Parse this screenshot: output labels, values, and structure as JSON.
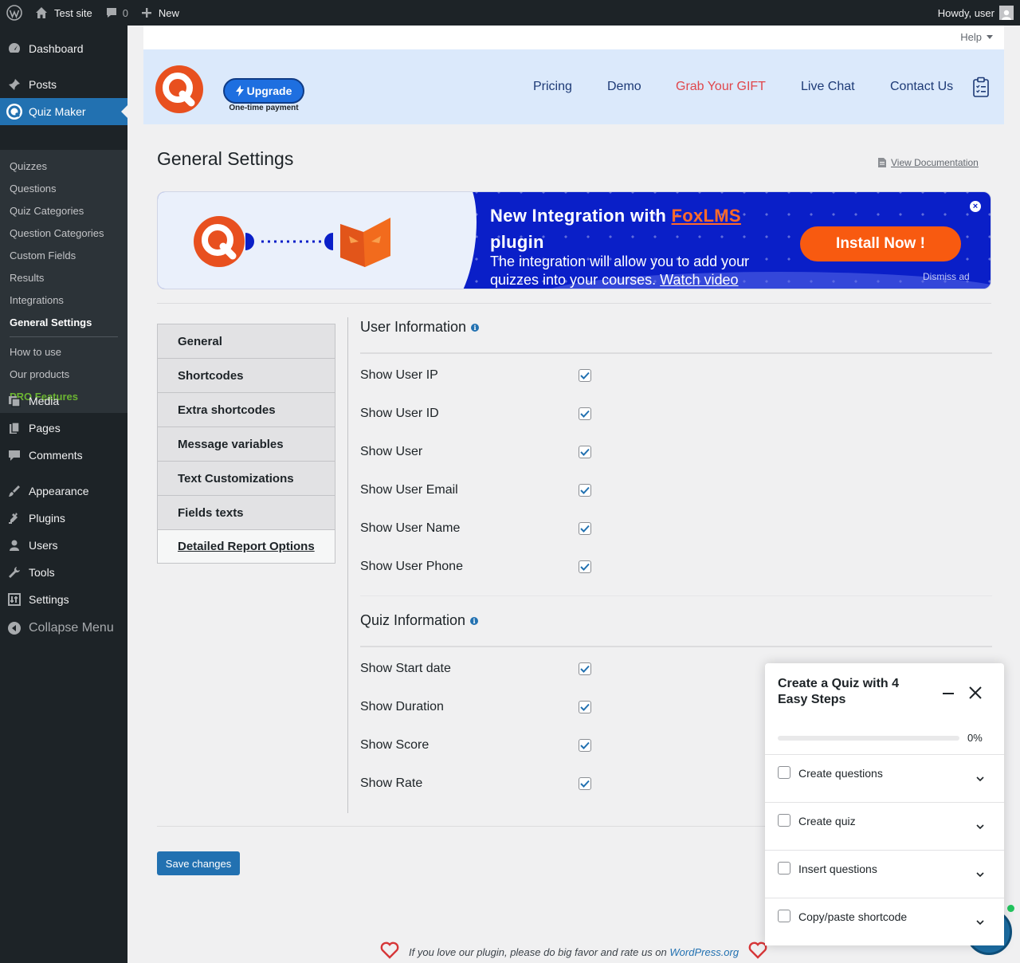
{
  "admin_bar": {
    "site_name": "Test site",
    "comments_count": "0",
    "new_label": "New",
    "greeting": "Howdy, user"
  },
  "sidebar": {
    "dashboard": "Dashboard",
    "posts": "Posts",
    "quiz_maker": "Quiz Maker",
    "submenu": [
      "Quizzes",
      "Questions",
      "Quiz Categories",
      "Question Categories",
      "Custom Fields",
      "Results",
      "Integrations",
      "General Settings"
    ],
    "submenu_extra": [
      "How to use",
      "Our products"
    ],
    "pro_features": "PRO Features",
    "media": "Media",
    "pages": "Pages",
    "comments": "Comments",
    "appearance": "Appearance",
    "plugins": "Plugins",
    "users": "Users",
    "tools": "Tools",
    "settings": "Settings",
    "collapse": "Collapse Menu"
  },
  "help": {
    "label": "Help"
  },
  "plugin_header": {
    "upgrade_label": "Upgrade",
    "upgrade_note": "One-time payment",
    "nav": [
      "Pricing",
      "Demo",
      "Grab Your GIFT",
      "Live Chat",
      "Contact Us"
    ],
    "brand_color": "#e8501f",
    "gift_color": "#e0474c"
  },
  "page": {
    "title": "General Settings",
    "view_doc": "View Documentation"
  },
  "banner": {
    "title_prefix": "New Integration with",
    "title_brand": "FoxLMS",
    "title_suffix": "plugin",
    "text": "The integration will allow you to add your quizzes into your courses.",
    "watch_video": "Watch video",
    "install_label": "Install Now !",
    "dismiss": "Dismiss ad",
    "close": "×"
  },
  "tabs": [
    {
      "label": "General"
    },
    {
      "label": "Shortcodes"
    },
    {
      "label": "Extra shortcodes"
    },
    {
      "label": "Message variables"
    },
    {
      "label": "Text Customizations"
    },
    {
      "label": "Fields texts"
    },
    {
      "label": "Detailed Report Options",
      "active": true
    }
  ],
  "sections": {
    "user_info": {
      "title": "User Information",
      "options": [
        {
          "label": "Show User IP",
          "checked": true
        },
        {
          "label": "Show User ID",
          "checked": true
        },
        {
          "label": "Show User",
          "checked": true
        },
        {
          "label": "Show User Email",
          "checked": true
        },
        {
          "label": "Show User Name",
          "checked": true
        },
        {
          "label": "Show User Phone",
          "checked": true
        }
      ]
    },
    "quiz_info": {
      "title": "Quiz Information",
      "options": [
        {
          "label": "Show Start date",
          "checked": true
        },
        {
          "label": "Show Duration",
          "checked": true
        },
        {
          "label": "Show Score",
          "checked": true
        },
        {
          "label": "Show Rate",
          "checked": true
        }
      ]
    }
  },
  "save_label": "Save changes",
  "footer": {
    "text": "If you love our plugin, please do big favor and rate us on",
    "link": "WordPress.org"
  },
  "wizard": {
    "title": "Create a Quiz with 4 Easy Steps",
    "progress_text": "0%",
    "progress": 0,
    "steps": [
      {
        "label": "Create questions",
        "checked": false
      },
      {
        "label": "Create quiz",
        "checked": false
      },
      {
        "label": "Insert questions",
        "checked": false
      },
      {
        "label": "Copy/paste shortcode",
        "checked": false
      }
    ]
  }
}
